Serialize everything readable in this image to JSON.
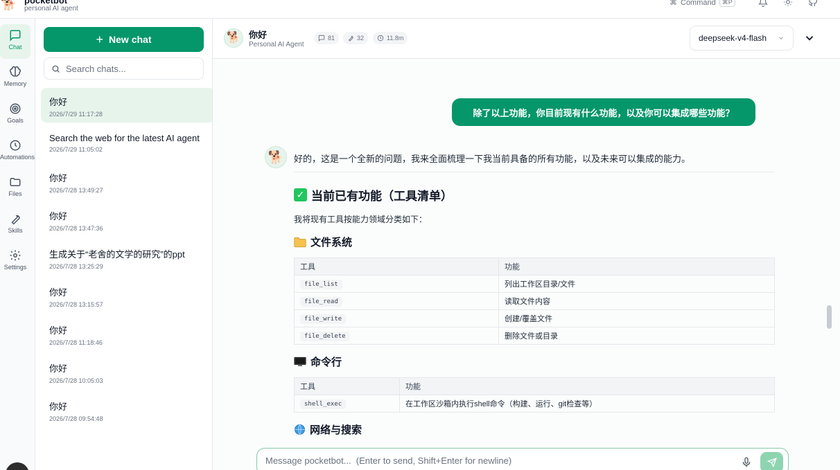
{
  "app": {
    "name": "pocketbot",
    "subtitle": "personal AI agent",
    "command_label": "Command",
    "command_kbd": "⌘P"
  },
  "rail": [
    {
      "id": "chat",
      "label": "Chat"
    },
    {
      "id": "memory",
      "label": "Memory"
    },
    {
      "id": "goals",
      "label": "Goals"
    },
    {
      "id": "automations",
      "label": "Automations"
    },
    {
      "id": "files",
      "label": "Files"
    },
    {
      "id": "skills",
      "label": "Skills"
    },
    {
      "id": "settings",
      "label": "Settings"
    }
  ],
  "sidebar": {
    "new_chat_label": "New chat",
    "search_placeholder": "Search chats...",
    "chats": [
      {
        "title": "你好",
        "date": "2026/7/29 11:17:28"
      },
      {
        "title": "Search the web for the latest AI agent",
        "date": "2026/7/29 11:05:02"
      },
      {
        "title": "你好",
        "date": "2026/7/28 13:49:27"
      },
      {
        "title": "你好",
        "date": "2026/7/28 13:47:36"
      },
      {
        "title": "生成关于“老舍的文学的研究”的ppt",
        "date": "2026/7/28 13:25:29"
      },
      {
        "title": "你好",
        "date": "2026/7/28 13:15:57"
      },
      {
        "title": "你好",
        "date": "2026/7/28 11:18:46"
      },
      {
        "title": "你好",
        "date": "2026/7/28 10:05:03"
      },
      {
        "title": "你好",
        "date": "2026/7/28 09:54:48"
      }
    ]
  },
  "header": {
    "title": "你好",
    "subtitle": "Personal AI Agent",
    "stats": {
      "messages": "81",
      "tools": "32",
      "time": "11.8m"
    },
    "model": "deepseek-v4-flash"
  },
  "conversation": {
    "user_message": "除了以上功能，你目前现有什么功能，以及你可以集成哪些功能？",
    "bot_intro": "好的，这是一个全新的问题，我来全面梳理一下我当前具备的所有功能，以及未来可以集成的能力。",
    "section_title": "当前已有功能（工具清单）",
    "section_desc": "我将现有工具按能力领域分类如下：",
    "fs_title": "文件系统",
    "fs_table": {
      "headers": [
        "工具",
        "功能"
      ],
      "rows": [
        [
          "file_list",
          "列出工作区目录/文件"
        ],
        [
          "file_read",
          "读取文件内容"
        ],
        [
          "file_write",
          "创建/覆盖文件"
        ],
        [
          "file_delete",
          "删除文件或目录"
        ]
      ]
    },
    "cli_title": "命令行",
    "cli_table": {
      "headers": [
        "工具",
        "功能"
      ],
      "rows": [
        [
          "shell_exec",
          "在工作区沙箱内执行shell命令（构建、运行、git检查等）"
        ]
      ]
    },
    "web_title": "网络与搜索"
  },
  "composer": {
    "placeholder": "Message pocketbot...  (Enter to send, Shift+Enter for newline)"
  }
}
